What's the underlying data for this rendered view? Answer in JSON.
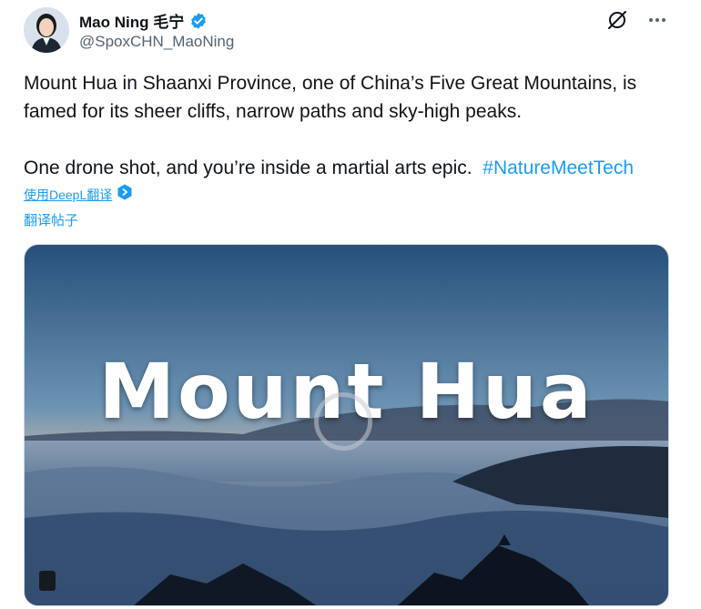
{
  "author": {
    "display_name": "Mao Ning 毛宁",
    "handle": "@SpoxCHN_MaoNing",
    "verified_color": "#1d9bf0"
  },
  "actions": {
    "grok_icon": "grok-icon",
    "more_icon": "more-icon"
  },
  "post": {
    "line1": "Mount Hua in Shaanxi Province, one of China’s Five Great Mountains, is famed for its sheer cliffs, narrow paths and sky-high peaks.",
    "line2": "One drone shot, and you’re inside a martial arts epic.",
    "hashtag": "#NatureMeetTech"
  },
  "translate": {
    "deepl_label": "使用DeepL翻译",
    "post_label": "翻译帖子"
  },
  "media": {
    "title": "Mount Hua",
    "accent_link_color": "#1d9bf0"
  }
}
